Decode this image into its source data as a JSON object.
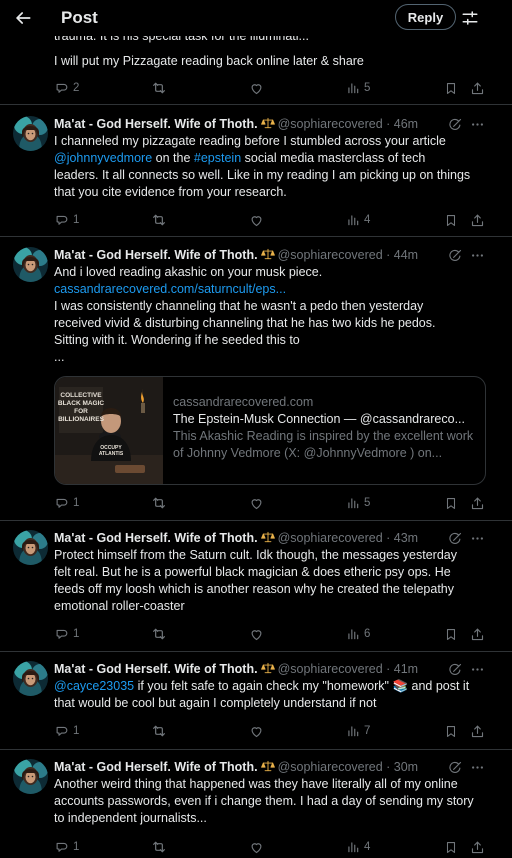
{
  "header": {
    "title": "Post",
    "reply_label": "Reply"
  },
  "previous_post": {
    "line1": "trauma.  It is his special task for the illuminati...",
    "line2": "I will put my Pizzagate reading back online later & share",
    "counts": {
      "replies": "2",
      "views": "5"
    }
  },
  "author": {
    "name": "Ma'at - God Herself. Wife of Thoth.",
    "badge_emoji": "⚖️",
    "handle": "@sophiarecovered"
  },
  "posts": [
    {
      "time": "46m",
      "lines": [
        "I channeled my pizzagate reading before I stumbled across your article",
        "@johnnyvedmore",
        "on the",
        "#epstein",
        "social media masterclass of tech",
        "leaders. It all connects so well. Like in my reading I am picking up on things",
        "that you cite evidence from your research."
      ],
      "counts": {
        "replies": "1",
        "views": "4"
      }
    },
    {
      "time": "44m",
      "lines": [
        "And i loved reading akashic on your musk piece.",
        "cassandrarecovered.com/saturncult/eps...",
        "I was consistently channeling that he wasn't a pedo then yesterday",
        "received vivid & disturbing channeling that he has two kids he pedos.",
        "Sitting with it. Wondering if he seeded this to",
        "..."
      ],
      "card": {
        "domain": "cassandrarecovered.com",
        "title": "The Epstein-Musk Connection — @cassandrareco...",
        "desc": "This Akashic Reading is inspired by the excellent work of Johnny Vedmore (X: @JohnnyVedmore ) on...",
        "image_text": [
          "COLLECTIVE",
          "BLACK MAGIC",
          "FOR",
          "BILLIONAIRES"
        ],
        "shirt_text": [
          "OCCUPY",
          "ATLANTIS"
        ]
      },
      "counts": {
        "replies": "1",
        "views": "5"
      }
    },
    {
      "time": "43m",
      "text": "Protect himself from the Saturn cult.  Idk though, the messages yesterday\nfelt real. But he is a powerful black magician & does etheric psy ops. He\nfeeds off my loosh which is another reason why he created the telepathy\nemotional roller-coaster",
      "counts": {
        "replies": "1",
        "views": "6"
      }
    },
    {
      "time": "41m",
      "lines": [
        "@cayce23035",
        "if you felt safe to again check my \"homework\"",
        "📚",
        "and post it",
        "that would be cool but again I completely understand if not"
      ],
      "counts": {
        "replies": "1",
        "views": "7"
      }
    },
    {
      "time": "30m",
      "text": "Another weird thing that happened was they have literally all of my online\naccounts passwords, even if i change them. I had a day of sending my story\nto independent journalists...",
      "counts": {
        "replies": "1",
        "views": "4"
      }
    }
  ],
  "colors": {
    "accent": "#1d9bf0",
    "muted": "#71767b",
    "border": "#2f3336",
    "text": "#e7e9ea"
  }
}
